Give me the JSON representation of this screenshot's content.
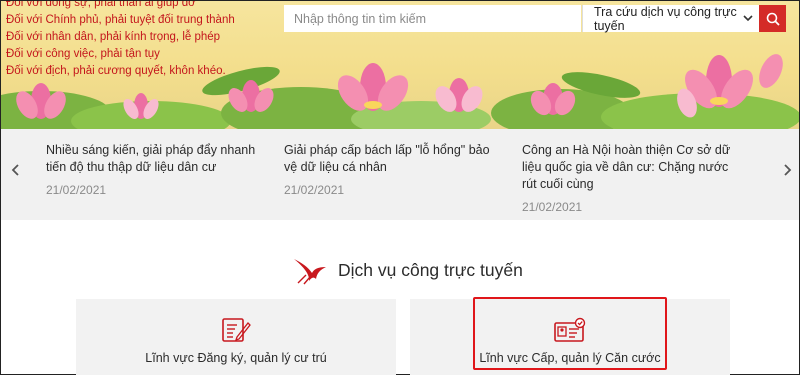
{
  "banner": {
    "motto": [
      "Đối với đồng sự, phải thân ái giúp đỡ",
      "Đối với Chính phủ, phải tuyệt đối trung thành",
      "Đối với nhân dân, phải kính trọng, lễ phép",
      "Đối với công việc, phải tận tụy",
      "Đối với địch, phải cương quyết, khôn khéo."
    ]
  },
  "search": {
    "placeholder": "Nhập thông tin tìm kiếm",
    "select_value": "Tra cứu dịch vụ công trực tuyến",
    "button_icon": "search-icon"
  },
  "news": [
    {
      "title": "Nhiều sáng kiến, giải pháp đẩy nhanh tiến độ thu thập dữ liệu dân cư",
      "date": "21/02/2021"
    },
    {
      "title": "Giải pháp cấp bách lấp \"lỗ hổng\" bảo vệ dữ liệu cá nhân",
      "date": "21/02/2021"
    },
    {
      "title": "Công an Hà Nội hoàn thiện Cơ sở dữ liệu quốc gia về dân cư: Chặng nước rút cuối cùng",
      "date": "21/02/2021"
    }
  ],
  "services": {
    "title": "Dịch vụ công trực tuyến",
    "cards": [
      {
        "label": "Lĩnh vực Đăng ký, quản lý cư trú",
        "icon": "registration-form-icon"
      },
      {
        "label": "Lĩnh vực Cấp, quản lý Căn cước",
        "icon": "id-card-icon"
      }
    ]
  },
  "colors": {
    "accent": "#d42b27",
    "motto": "#c4161c",
    "highlight": "#e0161a"
  }
}
